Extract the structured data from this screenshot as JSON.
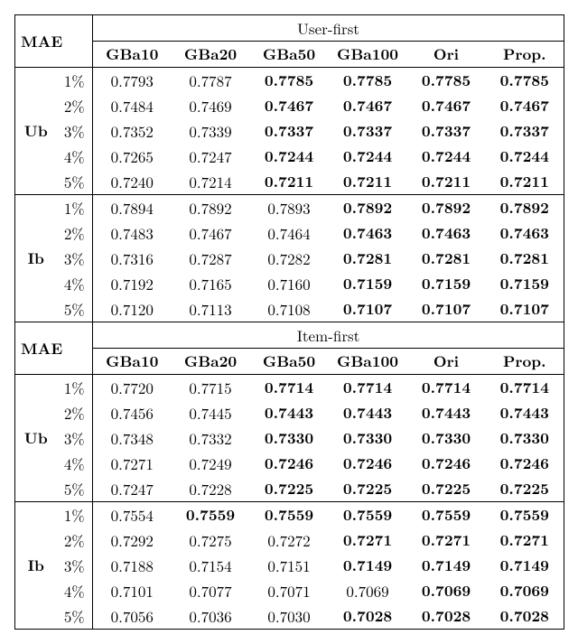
{
  "label_mae": "MAE",
  "section_user_first": "User-first",
  "section_item_first": "Item-first",
  "cols": {
    "gba10": "GBa10",
    "gba20": "GBa20",
    "gba50": "GBa50",
    "gba100": "GBa100",
    "ori": "Ori",
    "prop": "Prop."
  },
  "row_group_ub": "Ub",
  "row_group_ib": "Ib",
  "pct": {
    "p1": "1%",
    "p2": "2%",
    "p3": "3%",
    "p4": "4%",
    "p5": "5%"
  },
  "chart_data": [
    {
      "type": "table",
      "title": "MAE — User-first",
      "columns": [
        "GBa10",
        "GBa20",
        "GBa50",
        "GBa100",
        "Ori",
        "Prop."
      ],
      "groups": [
        {
          "name": "Ub",
          "rows": [
            {
              "pct": "1%",
              "values": [
                0.7793,
                0.7787,
                0.7785,
                0.7785,
                0.7785,
                0.7785
              ],
              "bold": [
                false,
                false,
                true,
                true,
                true,
                true
              ]
            },
            {
              "pct": "2%",
              "values": [
                0.7484,
                0.7469,
                0.7467,
                0.7467,
                0.7467,
                0.7467
              ],
              "bold": [
                false,
                false,
                true,
                true,
                true,
                true
              ]
            },
            {
              "pct": "3%",
              "values": [
                0.7352,
                0.7339,
                0.7337,
                0.7337,
                0.7337,
                0.7337
              ],
              "bold": [
                false,
                false,
                true,
                true,
                true,
                true
              ]
            },
            {
              "pct": "4%",
              "values": [
                0.7265,
                0.7247,
                0.7244,
                0.7244,
                0.7244,
                0.7244
              ],
              "bold": [
                false,
                false,
                true,
                true,
                true,
                true
              ]
            },
            {
              "pct": "5%",
              "values": [
                0.724,
                0.7214,
                0.7211,
                0.7211,
                0.7211,
                0.7211
              ],
              "bold": [
                false,
                false,
                true,
                true,
                true,
                true
              ]
            }
          ]
        },
        {
          "name": "Ib",
          "rows": [
            {
              "pct": "1%",
              "values": [
                0.7894,
                0.7892,
                0.7893,
                0.7892,
                0.7892,
                0.7892
              ],
              "bold": [
                false,
                false,
                false,
                true,
                true,
                true
              ]
            },
            {
              "pct": "2%",
              "values": [
                0.7483,
                0.7467,
                0.7464,
                0.7463,
                0.7463,
                0.7463
              ],
              "bold": [
                false,
                false,
                false,
                true,
                true,
                true
              ]
            },
            {
              "pct": "3%",
              "values": [
                0.7316,
                0.7287,
                0.7282,
                0.7281,
                0.7281,
                0.7281
              ],
              "bold": [
                false,
                false,
                false,
                true,
                true,
                true
              ]
            },
            {
              "pct": "4%",
              "values": [
                0.7192,
                0.7165,
                0.716,
                0.7159,
                0.7159,
                0.7159
              ],
              "bold": [
                false,
                false,
                false,
                true,
                true,
                true
              ]
            },
            {
              "pct": "5%",
              "values": [
                0.712,
                0.7113,
                0.7108,
                0.7107,
                0.7107,
                0.7107
              ],
              "bold": [
                false,
                false,
                false,
                true,
                true,
                true
              ]
            }
          ]
        }
      ]
    },
    {
      "type": "table",
      "title": "MAE — Item-first",
      "columns": [
        "GBa10",
        "GBa20",
        "GBa50",
        "GBa100",
        "Ori",
        "Prop."
      ],
      "groups": [
        {
          "name": "Ub",
          "rows": [
            {
              "pct": "1%",
              "values": [
                0.772,
                0.7715,
                0.7714,
                0.7714,
                0.7714,
                0.7714
              ],
              "bold": [
                false,
                false,
                true,
                true,
                true,
                true
              ]
            },
            {
              "pct": "2%",
              "values": [
                0.7456,
                0.7445,
                0.7443,
                0.7443,
                0.7443,
                0.7443
              ],
              "bold": [
                false,
                false,
                true,
                true,
                true,
                true
              ]
            },
            {
              "pct": "3%",
              "values": [
                0.7348,
                0.7332,
                0.733,
                0.733,
                0.733,
                0.733
              ],
              "bold": [
                false,
                false,
                true,
                true,
                true,
                true
              ]
            },
            {
              "pct": "4%",
              "values": [
                0.7271,
                0.7249,
                0.7246,
                0.7246,
                0.7246,
                0.7246
              ],
              "bold": [
                false,
                false,
                true,
                true,
                true,
                true
              ]
            },
            {
              "pct": "5%",
              "values": [
                0.7247,
                0.7228,
                0.7225,
                0.7225,
                0.7225,
                0.7225
              ],
              "bold": [
                false,
                false,
                true,
                true,
                true,
                true
              ]
            }
          ]
        },
        {
          "name": "Ib",
          "rows": [
            {
              "pct": "1%",
              "values": [
                0.7554,
                0.7559,
                0.7559,
                0.7559,
                0.7559,
                0.7559
              ],
              "bold": [
                false,
                true,
                true,
                true,
                true,
                true
              ]
            },
            {
              "pct": "2%",
              "values": [
                0.7292,
                0.7275,
                0.7272,
                0.7271,
                0.7271,
                0.7271
              ],
              "bold": [
                false,
                false,
                false,
                true,
                true,
                true
              ]
            },
            {
              "pct": "3%",
              "values": [
                0.7188,
                0.7154,
                0.7151,
                0.7149,
                0.7149,
                0.7149
              ],
              "bold": [
                false,
                false,
                false,
                true,
                true,
                true
              ]
            },
            {
              "pct": "4%",
              "values": [
                0.7101,
                0.7077,
                0.7071,
                0.7069,
                0.7069,
                0.7069
              ],
              "bold": [
                false,
                false,
                false,
                false,
                true,
                true
              ]
            },
            {
              "pct": "5%",
              "values": [
                0.7056,
                0.7036,
                0.703,
                0.7028,
                0.7028,
                0.7028
              ],
              "bold": [
                false,
                false,
                false,
                true,
                true,
                true
              ]
            }
          ]
        }
      ]
    }
  ]
}
